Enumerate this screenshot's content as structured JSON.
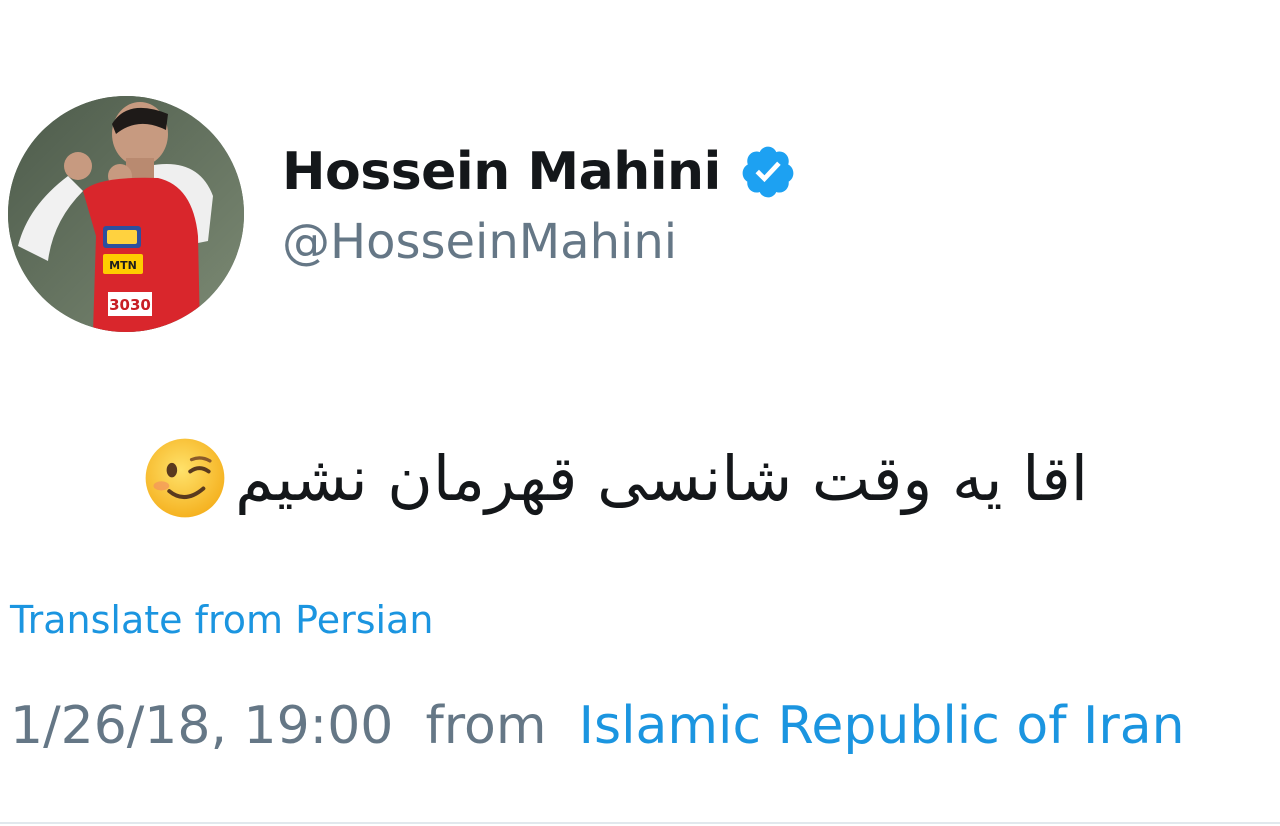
{
  "user": {
    "display_name": "Hossein Mahini",
    "handle": "@HosseinMahini",
    "verified": true,
    "avatar_icon": "profile-photo-football-player",
    "jersey_number": "3030",
    "sponsor_text": "MTN"
  },
  "tweet": {
    "text": "اقا یه وقت شانسی قهرمان نشیم",
    "emoji_icon": "winking-face-emoji"
  },
  "translate": {
    "label": "Translate from Persian"
  },
  "meta": {
    "timestamp": "1/26/18, 19:00",
    "from_word": "from",
    "location": "Islamic Republic of Iran"
  },
  "colors": {
    "link": "#1b95e0",
    "secondary_text": "#657786",
    "primary_text": "#14171a",
    "verified_badge": "#1da1f2",
    "jersey_red": "#d9262c"
  }
}
